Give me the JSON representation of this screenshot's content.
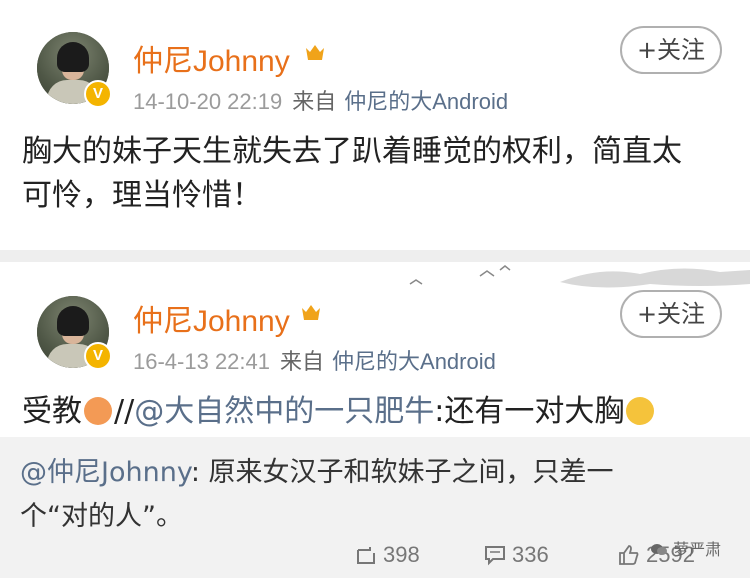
{
  "posts": [
    {
      "username": "仲尼Johnny",
      "verified_badge": "V",
      "timestamp": "14-10-20 22:19",
      "source_label": "来自",
      "source_device": "仲尼的大Android",
      "follow_label": "+关注",
      "text_lines": [
        "胸大的妹子天生就失去了趴着睡觉的权利，简直太",
        "可怜，理当怜惜！"
      ]
    },
    {
      "username": "仲尼Johnny",
      "verified_badge": "V",
      "timestamp": "16-4-13 22:41",
      "source_label": "来自",
      "source_device": "仲尼的大Android",
      "follow_label": "+关注",
      "text_prefix": "受教",
      "text_sep": "//",
      "text_mention": "@大自然中的一只肥牛",
      "text_suffix": ":还有一对大胸",
      "quote_mention": "@仲尼Johnny",
      "quote_text_line1": ": 原来女汉子和软妹子之间，只差一",
      "quote_text_line2": "个“对的人”。",
      "repost_count": "398",
      "comment_count": "336",
      "like_count": "2592"
    }
  ],
  "watermark": "萝严肃",
  "icons": {
    "crown": "crown-icon",
    "repost": "repost-icon",
    "comment": "comment-icon",
    "like": "like-icon",
    "emoji_sad": "sad-emoji-icon",
    "emoji_smile": "smile-emoji-icon"
  },
  "colors": {
    "username": "#e8701a",
    "mention": "#5a6f8a",
    "badge": "#f4b400"
  }
}
